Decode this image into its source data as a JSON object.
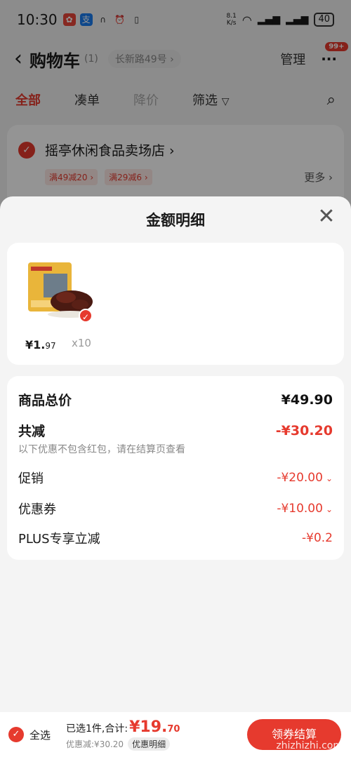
{
  "status_bar": {
    "time": "10:30",
    "net_speed": "8.1",
    "net_unit": "K/s",
    "battery": "40"
  },
  "nav": {
    "title": "购物车",
    "count": "(1)",
    "address": "长新路49号 ›",
    "manage": "管理",
    "badge": "99+"
  },
  "tabs": [
    "全部",
    "凑单",
    "降价",
    "筛选"
  ],
  "store": {
    "name": "摇亭休闲食品卖场店 ›",
    "promos": [
      "满49减20 ›",
      "满29减6 ›"
    ],
    "more": "更多 ›"
  },
  "sheet": {
    "title": "金额明细",
    "item": {
      "price_int": "¥1.",
      "price_dec": "97",
      "qty": "x10"
    },
    "total": {
      "label": "商品总价",
      "value": "¥49.90"
    },
    "discount": {
      "label": "共减",
      "value": "-¥30.20",
      "note": "以下优惠不包含红包，请在结算页查看"
    },
    "rows": [
      {
        "label": "促销",
        "value": "-¥20.00"
      },
      {
        "label": "优惠券",
        "value": "-¥10.00"
      },
      {
        "label": "PLUS专享立减",
        "value": "-¥0.2"
      }
    ]
  },
  "bottom": {
    "select_all": "全选",
    "selected_text": "已选1件,合计:",
    "total_int": "¥19.",
    "total_dec": "70",
    "saved": "优惠减:¥30.20",
    "detail_btn": "优惠明细",
    "checkout": "领券结算",
    "watermark": "zhizhizhi.com"
  },
  "colors": {
    "accent": "#e63a2e"
  }
}
